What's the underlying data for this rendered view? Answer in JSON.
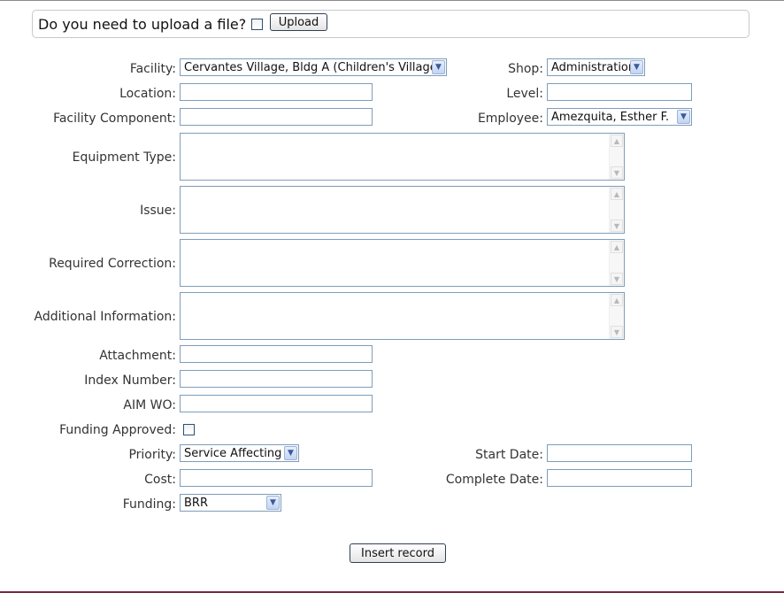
{
  "upload": {
    "question": "Do you need to upload a file?",
    "button_label": "Upload"
  },
  "labels": {
    "facility": "Facility:",
    "shop": "Shop:",
    "location": "Location:",
    "level": "Level:",
    "facility_component": "Facility Component:",
    "employee": "Employee:",
    "equipment_type": "Equipment Type:",
    "issue": "Issue:",
    "required_correction": "Required Correction:",
    "additional_information": "Additional Information:",
    "attachment": "Attachment:",
    "index_number": "Index Number:",
    "aim_wo": "AIM WO:",
    "funding_approved": "Funding Approved:",
    "priority": "Priority:",
    "start_date": "Start Date:",
    "cost": "Cost:",
    "complete_date": "Complete Date:",
    "funding": "Funding:"
  },
  "values": {
    "facility": "Cervantes Village, Bldg A (Children's Village)",
    "shop": "Administration",
    "employee": "Amezquita, Esther F.",
    "priority": "Service Affecting",
    "funding": "BRR"
  },
  "submit_label": "Insert record",
  "icons": {
    "dropdown": "chevron-down-icon",
    "scroll_up": "scroll-up-arrow-icon",
    "scroll_down": "scroll-down-arrow-icon"
  }
}
